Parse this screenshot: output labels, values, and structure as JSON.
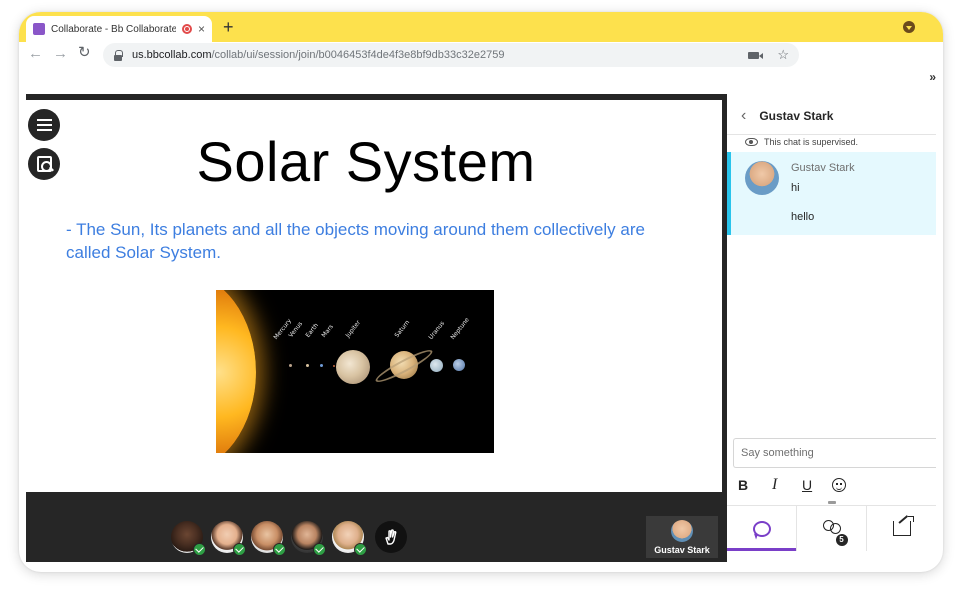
{
  "browser": {
    "tab": {
      "title": "Collaborate - Bb Collaborate",
      "close_label": "×"
    },
    "new_tab_label": "+",
    "url_host": "us.bbcollab.com",
    "url_path": "/collab/ui/session/join/b0046453f4de4f3e8bf9db33c32e2759",
    "extensions_label": "»",
    "icons": [
      "back-arrow-icon",
      "forward-arrow-icon",
      "reload-icon",
      "lock-icon",
      "camera-icon",
      "star-icon",
      "profile-icon",
      "recording-icon"
    ]
  },
  "stage": {
    "slide": {
      "title": "Solar System",
      "bullet": "- The Sun, Its planets and all the objects moving around them collectively are called Solar System.",
      "image_labels": [
        "Mercury",
        "Venus",
        "Earth",
        "Mars",
        "Jupiter",
        "Saturn",
        "Uranus",
        "Neptune"
      ]
    },
    "icons": [
      "menu-icon",
      "document-search-icon"
    ]
  },
  "bottom_bar": {
    "attendees": [
      {
        "status": "present",
        "status_icon": "check-icon"
      },
      {
        "status": "present",
        "status_icon": "check-icon"
      },
      {
        "status": "present",
        "status_icon": "check-icon"
      },
      {
        "status": "present",
        "status_icon": "check-icon"
      },
      {
        "status": "present",
        "status_icon": "check-icon"
      }
    ],
    "raise_hand_icon": "raise-hand-icon",
    "me": {
      "name": "Gustav Stark"
    }
  },
  "panel": {
    "title": "Gustav Stark",
    "supervised_notice": "This chat is supervised.",
    "messages": [
      {
        "author": "Gustav Stark",
        "lines": [
          "hi",
          "hello"
        ]
      }
    ],
    "compose_placeholder": "Say something",
    "format": {
      "bold": "B",
      "italic": "I",
      "underline": "U"
    },
    "tabs": [
      {
        "icon": "chat-icon",
        "active": true
      },
      {
        "icon": "attendees-icon",
        "count": "5"
      },
      {
        "icon": "share-content-icon"
      }
    ],
    "colors": {
      "accent": "#7a3fc8",
      "message_bg": "#e5f9fe",
      "message_border": "#29c4ec",
      "slide_text": "#3d7ee0",
      "check": "#2e9e44"
    }
  }
}
